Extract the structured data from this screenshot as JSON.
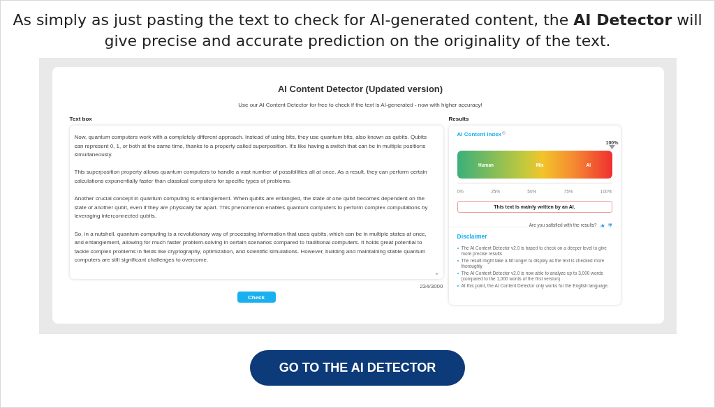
{
  "headline": "As simply as just pasting the text to check for AI-generated content, the **AI Detector** will give precise and accurate prediction on the originality of the text.",
  "detector": {
    "title": "AI Content Detector (Updated version)",
    "subtitle": "Use our AI Content Detector for free to check if the text is AI-generated - now with higher accuracy!",
    "text_box": {
      "label": "Text box",
      "paragraphs": [
        "Now, quantum computers work with a completely different approach. Instead of using bits, they use quantum bits, also known as qubits. Qubits can represent 0, 1, or both at the same time, thanks to a property called superposition. It's like having a switch that can be in multiple positions simultaneously.",
        "This superposition property allows quantum computers to handle a vast number of possibilities all at once. As a result, they can perform certain calculations exponentially faster than classical computers for specific types of problems.",
        "Another crucial concept in quantum computing is entanglement. When qubits are entangled, the state of one qubit becomes dependent on the state of another qubit, even if they are physically far apart. This phenomenon enables quantum computers to perform complex computations by leveraging interconnected qubits.",
        "So, in a nutshell, quantum computing is a revolutionary way of processing information that uses qubits, which can be in multiple states at once, and entanglement, allowing for much faster problem-solving in certain scenarios compared to traditional computers. It holds great potential to tackle complex problems in fields like cryptography, optimization, and scientific simulations. However, building and maintaining stable quantum computers are still significant challenges to overcome."
      ],
      "counter": "234/3000"
    },
    "check_button": "Check",
    "results": {
      "label": "Results",
      "index_title": "AI Content Index",
      "gauge": {
        "reading": "100%",
        "zones": [
          "Human",
          "Mix",
          "AI"
        ],
        "ticks": [
          "0%",
          "25%",
          "50%",
          "75%",
          "100%"
        ]
      },
      "verdict": "This text is mainly written by an AI.",
      "feedback": "Are you satisfied with the results?",
      "disclaimer_title": "Disclaimer",
      "disclaimer": [
        "The AI Content Detector v2.0 is based to check on a deeper level to give more precise results",
        "The result might take a bit longer to display as the text is checked more thoroughly",
        "The AI Content Detector v2.0 is now able to analyze up to 3,000 words (compared to the 1,000 words of the first version)",
        "At this point, the AI Content Detector only works for the English language."
      ]
    }
  },
  "cta_button": "GO TO THE AI DETECTOR"
}
